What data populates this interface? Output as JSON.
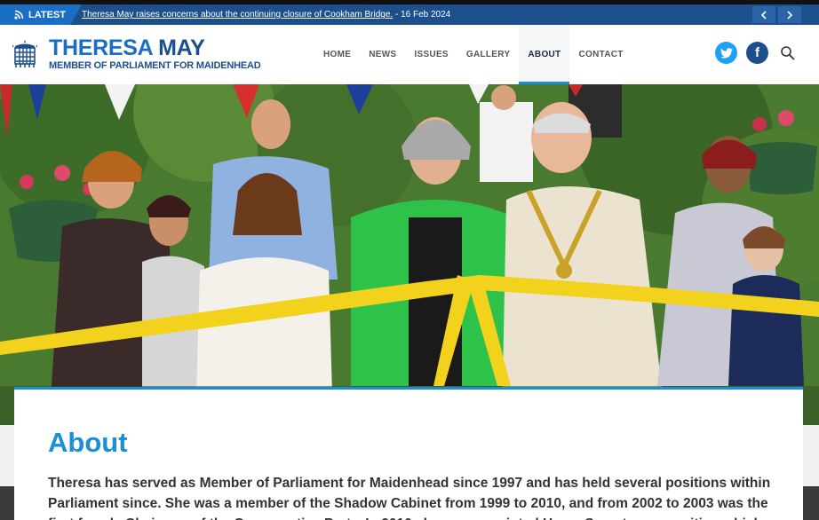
{
  "ticker": {
    "label": "LATEST",
    "headline": "Theresa May raises concerns about the continuing closure of Cookham Bridge.",
    "date": " - 16 Feb 2024",
    "prev_icon": "chevron-left-icon",
    "next_icon": "chevron-right-icon"
  },
  "brand": {
    "first_name": "THERESA",
    "last_name": "MAY",
    "subtitle": "MEMBER OF PARLIAMENT FOR MAIDENHEAD",
    "logo_icon": "portcullis-icon"
  },
  "nav": {
    "items": [
      {
        "label": "HOME"
      },
      {
        "label": "NEWS"
      },
      {
        "label": "ISSUES"
      },
      {
        "label": "GALLERY"
      },
      {
        "label": "ABOUT",
        "active": true
      },
      {
        "label": "CONTACT"
      }
    ]
  },
  "social": {
    "twitter_icon": "twitter-icon",
    "facebook_icon": "facebook-icon",
    "facebook_glyph": "f",
    "search_icon": "search-icon"
  },
  "colors": {
    "brand_blue": "#1a6fc4",
    "dark_blue": "#1d4f8c",
    "accent": "#1a8fd4"
  },
  "about": {
    "title": "About",
    "body": "Theresa has served as Member of Parliament for Maidenhead since 1997 and has held several positions within Parliament since. She was a member of the Shadow Cabinet from 1999 to 2010, and from 2002 to 2003 was the first female Chairman of the Conservative Party. In 2010 she was appointed Home Secretary, a position which"
  }
}
